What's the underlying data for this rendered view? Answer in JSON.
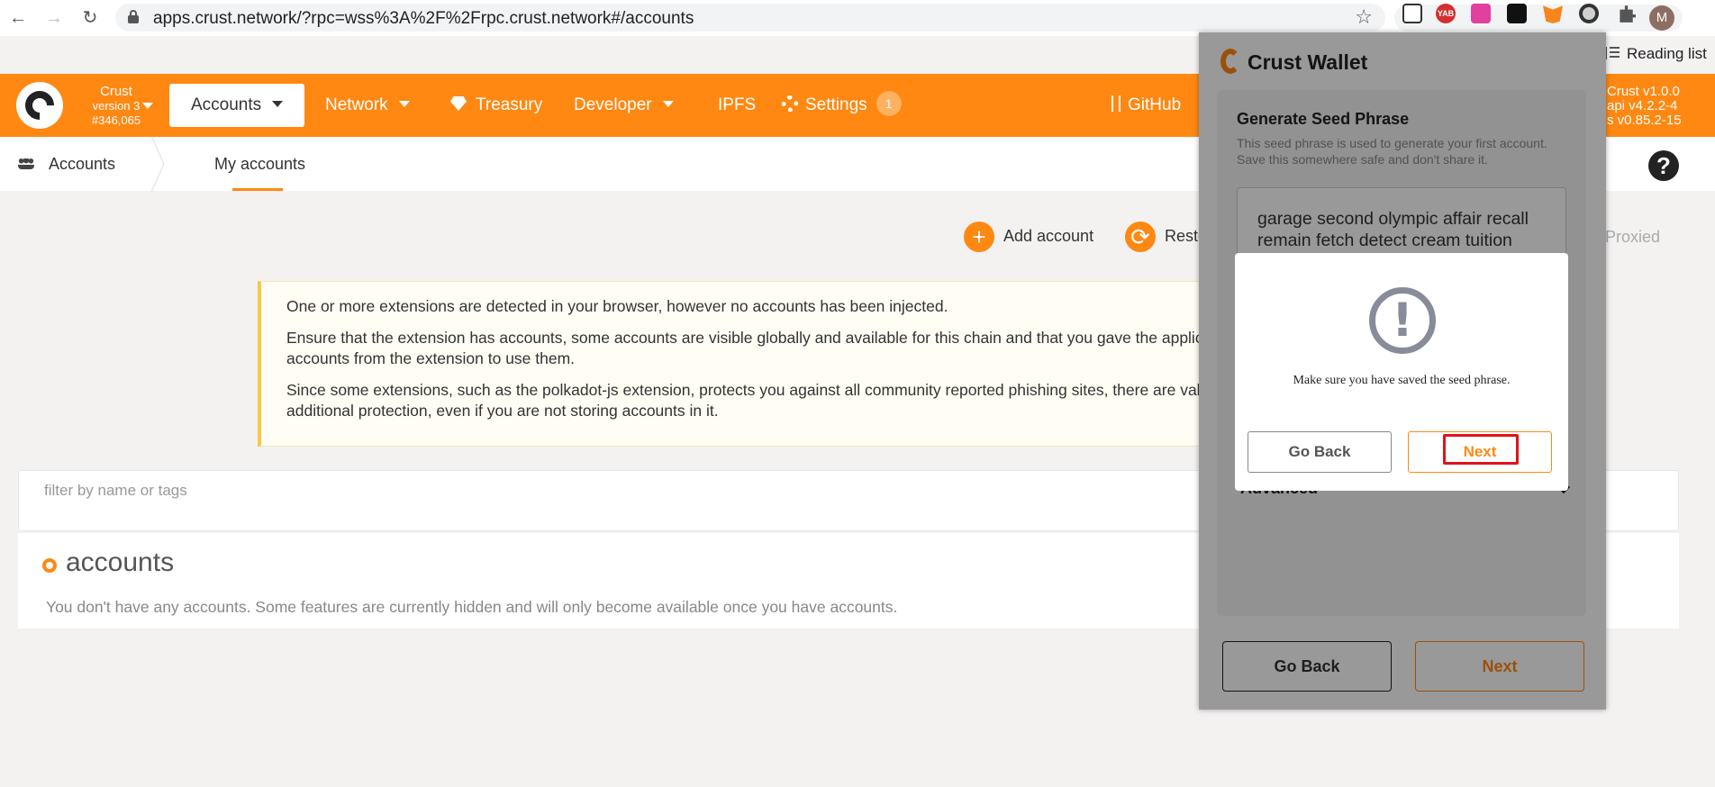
{
  "browser": {
    "url": "apps.crust.network/?rpc=wss%3A%2F%2Frpc.crust.network#/accounts",
    "avatar_letter": "M",
    "reading_list": "Reading list",
    "extensions": [
      "cube-icon",
      "yab-icon",
      "pink-square-icon",
      "mask-icon",
      "metamask-fox-icon",
      "crust-icon",
      "puzzle-icon"
    ],
    "yab_label": "YAB"
  },
  "topnav": {
    "chain_name": "Crust",
    "chain_version": "version 3",
    "block": "#346,065",
    "items": [
      {
        "label": "Accounts"
      },
      {
        "label": "Network"
      },
      {
        "label": "Treasury"
      },
      {
        "label": "Developer"
      },
      {
        "label": "IPFS"
      },
      {
        "label": "Settings"
      },
      {
        "label": "GitHub"
      }
    ],
    "settings_badge": "1",
    "versions": [
      "Crust v1.0.0",
      "api v4.2.2-4",
      "s v0.85.2-15"
    ],
    "accent": "#ff8812"
  },
  "subbar": {
    "section": "Accounts",
    "tab": "My accounts"
  },
  "actions": {
    "add": "Add account",
    "restore": "Resto",
    "proxied": "Proxied"
  },
  "warning": {
    "lines": [
      "One or more extensions are detected in your browser, however no accounts has been injected.",
      "Ensure that the extension has accounts, some accounts are visible globally and available for this chain and that you gave the applica",
      "accounts from the extension to use them.",
      "Since some extensions, such as the polkadot-js extension, protects you against all community reported phishing sites, there are valic",
      "additional protection, even if you are not storing accounts in it."
    ]
  },
  "filter": {
    "placeholder": "filter by name or tags"
  },
  "accounts": {
    "title": "accounts",
    "empty": "You don't have any accounts. Some features are currently hidden and will only become available once you have accounts."
  },
  "wallet": {
    "title": "Crust Wallet",
    "section_title": "Generate Seed Phrase",
    "section_desc_1": "This seed phrase is used to generate your first account.",
    "section_desc_2": "Save this somewhere safe and don't share it.",
    "seed_line_1": "garage second olympic affair recall",
    "seed_line_2": "remain fetch detect cream tuition",
    "advanced": "Advanced",
    "go_back": "Go Back",
    "next": "Next"
  },
  "dialog": {
    "message": "Make sure you have saved the seed phrase.",
    "go_back": "Go Back",
    "next": "Next"
  }
}
